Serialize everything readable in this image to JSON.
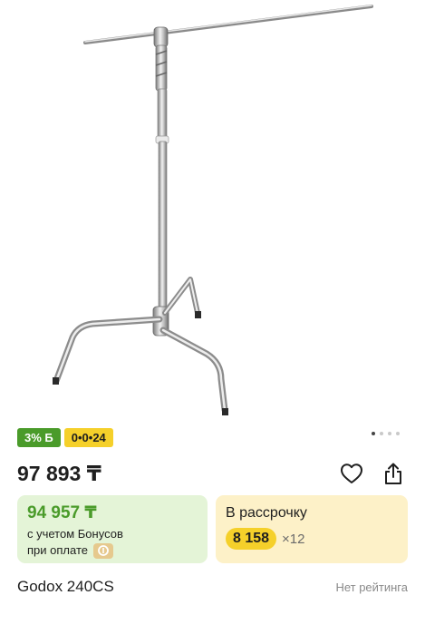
{
  "product": {
    "image_alt": "C-stand",
    "bonus_badge": "3% Б",
    "installment_badge": "0•0•24",
    "price": "97 893 ₸",
    "bonus_price": "94 957 ₸",
    "bonus_caption_line1": "с учетом Бонусов",
    "bonus_caption_line2": "при оплате",
    "credit_title": "В рассрочку",
    "credit_amount": "8 158",
    "credit_multiplier": "×12",
    "title": "Godox 240CS",
    "rating_text": "Нет рейтинга"
  },
  "gallery": {
    "page_count": 4,
    "active_index": 0
  },
  "colors": {
    "bonus_green": "#4a9b2a",
    "installment_yellow": "#f5d02a",
    "bonus_card_bg": "#e4f4d7",
    "credit_card_bg": "#fdf1c8",
    "kaspi_chip": "#e6c98e"
  },
  "icons": {
    "favorite": "heart-outline-icon",
    "share": "share-icon",
    "kaspi": "kaspi-logo-icon"
  }
}
